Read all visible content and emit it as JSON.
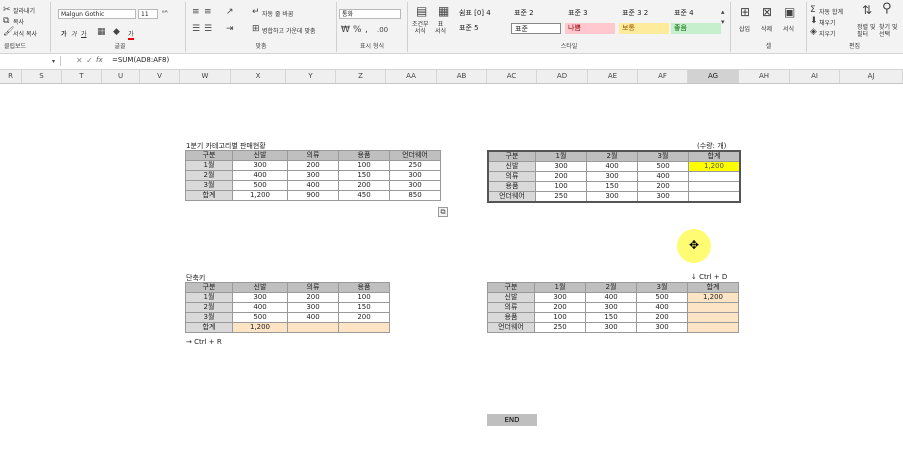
{
  "ribbon": {
    "clipboard": {
      "cut": "잘라내기",
      "copy": "복사",
      "format_painter": "서식 복사",
      "label": "클립보드"
    },
    "font": {
      "name": "Malgun Gothic",
      "size": "11",
      "label": "글꼴",
      "bold": "가",
      "italic": "가",
      "underline": "가",
      "color_a": "가"
    },
    "align": {
      "wrap": "자동 줄 바꿈",
      "merge": "병합하고 가운데 맞춤",
      "label": "맞춤"
    },
    "number": {
      "format": "통화",
      "label": "표시 형식"
    },
    "styles": {
      "cond_format": "조건부\n서식",
      "table_format": "표\n서식",
      "label": "스타일",
      "cells": [
        {
          "text": "쉼표 [0] 4",
          "bg": "#f3f3f3",
          "color": "#222"
        },
        {
          "text": "표준 2",
          "bg": "#f3f3f3",
          "color": "#222"
        },
        {
          "text": "표준 3",
          "bg": "#f3f3f3",
          "color": "#222"
        },
        {
          "text": "표준 3 2",
          "bg": "#f3f3f3",
          "color": "#222"
        },
        {
          "text": "표준 4",
          "bg": "#f3f3f3",
          "color": "#222"
        },
        {
          "text": "표준 5",
          "bg": "#f3f3f3",
          "color": "#222"
        },
        {
          "text": "표준",
          "bg": "#ffffff",
          "color": "#222"
        },
        {
          "text": "나쁨",
          "bg": "#ffc7ce",
          "color": "#9c0006"
        },
        {
          "text": "보통",
          "bg": "#ffeb9c",
          "color": "#9c5700"
        },
        {
          "text": "좋음",
          "bg": "#c6efce",
          "color": "#006100"
        }
      ]
    },
    "cells": {
      "insert": "삽입",
      "delete": "삭제",
      "format": "서식",
      "label": "셀"
    },
    "editing": {
      "autosum": "자동 합계",
      "fill": "채우기",
      "clear": "지우기",
      "sort": "정렬 및\n필터",
      "find": "찾기 및\n선택",
      "label": "편집"
    }
  },
  "formula_bar": {
    "name_box": "",
    "fx": "fx",
    "formula": "=SUM(AD8:AF8)"
  },
  "columns": [
    "R",
    "S",
    "T",
    "U",
    "V",
    "W",
    "X",
    "Y",
    "Z",
    "AA",
    "AB",
    "AC",
    "AD",
    "AE",
    "AF",
    "AG",
    "AH",
    "AI",
    "AJ"
  ],
  "selected_column": "AG",
  "table1": {
    "title": "1분기 카테고리별 판매현황",
    "headers": [
      "구분",
      "신발",
      "의류",
      "용품",
      "언더웨어"
    ],
    "rows": [
      [
        "1월",
        "300",
        "200",
        "100",
        "250"
      ],
      [
        "2월",
        "400",
        "300",
        "150",
        "300"
      ],
      [
        "3월",
        "500",
        "400",
        "200",
        "300"
      ],
      [
        "합계",
        "1,200",
        "900",
        "450",
        "850"
      ]
    ]
  },
  "table2": {
    "unit": "(수량: 개)",
    "headers": [
      "구분",
      "1월",
      "2월",
      "3월",
      "합계"
    ],
    "rows": [
      [
        "신발",
        "300",
        "400",
        "500",
        "1,200"
      ],
      [
        "의류",
        "200",
        "300",
        "400",
        ""
      ],
      [
        "용품",
        "100",
        "150",
        "200",
        ""
      ],
      [
        "언더웨어",
        "250",
        "300",
        "300",
        ""
      ]
    ]
  },
  "table3": {
    "title": "단축키",
    "headers": [
      "구분",
      "신발",
      "의류",
      "용품"
    ],
    "rows": [
      [
        "1월",
        "300",
        "200",
        "100"
      ],
      [
        "2월",
        "400",
        "300",
        "150"
      ],
      [
        "3월",
        "500",
        "400",
        "200"
      ],
      [
        "합계",
        "1,200",
        "",
        ""
      ]
    ],
    "note": "→ Ctrl + R"
  },
  "table4": {
    "note": "↓ Ctrl + D",
    "headers": [
      "구분",
      "1월",
      "2월",
      "3월",
      "합계"
    ],
    "rows": [
      [
        "신발",
        "300",
        "400",
        "500",
        "1,200"
      ],
      [
        "의류",
        "200",
        "300",
        "400",
        ""
      ],
      [
        "용품",
        "100",
        "150",
        "200",
        ""
      ],
      [
        "언더웨어",
        "250",
        "300",
        "300",
        ""
      ]
    ]
  },
  "end_label": "END"
}
